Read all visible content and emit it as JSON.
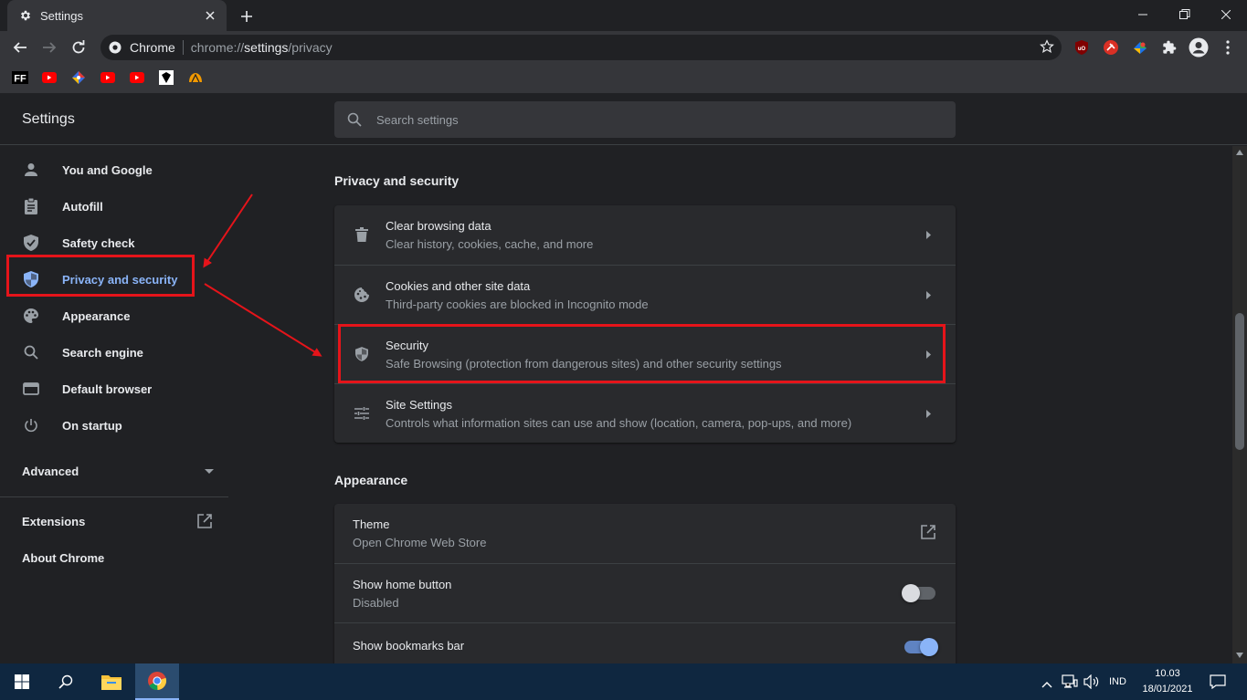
{
  "browser": {
    "tab_title": "Settings",
    "site_name": "Chrome",
    "url_scheme": "chrome://",
    "url_host": "settings",
    "url_path": "/privacy",
    "bookmarks": [
      "FF-icon",
      "youtube-icon",
      "kite-icon",
      "youtube-icon",
      "youtube-icon",
      "diamond-icon",
      "fan-icon"
    ],
    "extensions": [
      "ublock-icon",
      "red-ext-icon",
      "colorful-ext-icon",
      "puzzle-icon",
      "profile-icon",
      "menu-icon"
    ]
  },
  "header": {
    "title": "Settings",
    "search_placeholder": "Search settings"
  },
  "sidebar": {
    "items": [
      {
        "label": "You and Google",
        "icon": "person-icon"
      },
      {
        "label": "Autofill",
        "icon": "clipboard-icon"
      },
      {
        "label": "Safety check",
        "icon": "shield-check-icon"
      },
      {
        "label": "Privacy and security",
        "icon": "shield-icon",
        "active": true
      },
      {
        "label": "Appearance",
        "icon": "palette-icon"
      },
      {
        "label": "Search engine",
        "icon": "search-icon"
      },
      {
        "label": "Default browser",
        "icon": "browser-icon"
      },
      {
        "label": "On startup",
        "icon": "power-icon"
      }
    ],
    "advanced": "Advanced",
    "extensions": "Extensions",
    "about": "About Chrome"
  },
  "privacy": {
    "title": "Privacy and security",
    "rows": [
      {
        "title": "Clear browsing data",
        "subtitle": "Clear history, cookies, cache, and more",
        "icon": "trash-icon"
      },
      {
        "title": "Cookies and other site data",
        "subtitle": "Third-party cookies are blocked in Incognito mode",
        "icon": "cookie-icon"
      },
      {
        "title": "Security",
        "subtitle": "Safe Browsing (protection from dangerous sites) and other security settings",
        "icon": "shield-icon"
      },
      {
        "title": "Site Settings",
        "subtitle": "Controls what information sites can use and show (location, camera, pop-ups, and more)",
        "icon": "tune-icon"
      }
    ]
  },
  "appearance": {
    "title": "Appearance",
    "rows": [
      {
        "title": "Theme",
        "subtitle": "Open Chrome Web Store"
      },
      {
        "title": "Show home button",
        "subtitle": "Disabled",
        "toggle": false
      },
      {
        "title": "Show bookmarks bar",
        "toggle": true
      }
    ]
  },
  "taskbar": {
    "language": "IND",
    "time": "10.03",
    "date": "18/01/2021"
  },
  "colors": {
    "accent": "#8ab4f8",
    "annotation": "#e5141a",
    "taskbar": "#0f2740"
  }
}
